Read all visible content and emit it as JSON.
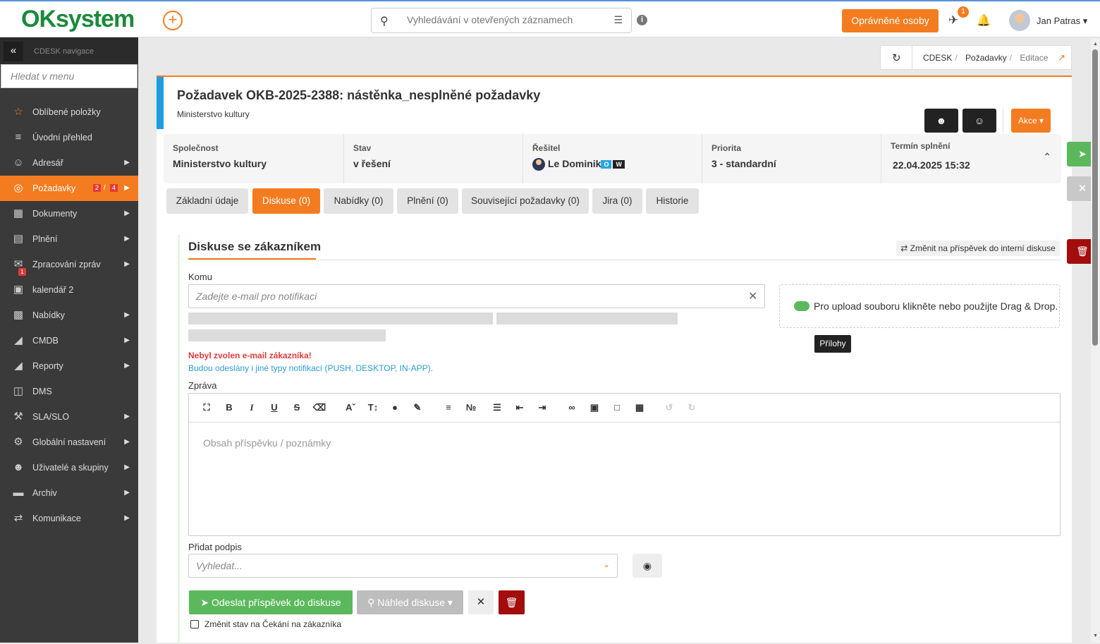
{
  "app": {
    "logo": "OKsystem"
  },
  "header": {
    "search_placeholder": "Vyhledávání v otevřených záznamech",
    "authorized_button": "Oprávněné osoby",
    "notification_count": "1",
    "user_name": "Jan Patras ▾",
    "accent_color": "#f47c20"
  },
  "sidebar": {
    "title": "CDESK navigace",
    "search_placeholder": "Hledat v menu",
    "items": [
      {
        "label": "Oblíbené položky",
        "icon": "star-icon"
      },
      {
        "label": "Úvodní přehled",
        "icon": "list-icon"
      },
      {
        "label": "Adresář",
        "icon": "user-icon"
      },
      {
        "label": "Požadavky",
        "icon": "lifebuoy-icon",
        "count_a": "2",
        "count_b": "4"
      },
      {
        "label": "Dokumenty",
        "icon": "books-icon"
      },
      {
        "label": "Plnění",
        "icon": "clipboard-icon"
      },
      {
        "label": "Zpracování zpráv",
        "icon": "envelope-icon",
        "badge": "1"
      },
      {
        "label": "kalendář 2",
        "icon": "calendar-icon"
      },
      {
        "label": "Nabídky",
        "icon": "gift-icon"
      },
      {
        "label": "CMDB",
        "icon": "folder-open-icon"
      },
      {
        "label": "Reporty",
        "icon": "folder-open-icon"
      },
      {
        "label": "DMS",
        "icon": "database-icon"
      },
      {
        "label": "SLA/SLO",
        "icon": "gavel-icon"
      },
      {
        "label": "Globální nastavení",
        "icon": "gears-icon"
      },
      {
        "label": "Uživatelé a skupiny",
        "icon": "users-icon"
      },
      {
        "label": "Archiv",
        "icon": "archive-icon"
      },
      {
        "label": "Komunikace",
        "icon": "exchange-icon"
      }
    ]
  },
  "breadcrumb": {
    "items": [
      "CDESK",
      "Požadavky",
      "Editace"
    ]
  },
  "request": {
    "title": "Požadavek OKB-2025-2388: nástěnka_nesplněné požadavky",
    "subtitle": "Ministerstvo kultury",
    "akce_label": "Akce ▾",
    "fields": [
      {
        "label": "Společnost",
        "value": "Ministerstvo kultury"
      },
      {
        "label": "Stav",
        "value": "v řešení"
      },
      {
        "label": "Řešitel",
        "value": "Le Dominik",
        "tag_o": "O",
        "tag_w": "W"
      },
      {
        "label": "Priorita",
        "value": "3 - standardní"
      },
      {
        "label": "Termín splnění",
        "value": "22.04.2025 15:32"
      }
    ]
  },
  "tabs": [
    "Základní údaje",
    "Diskuse (0)",
    "Nabídky (0)",
    "Plnění (0)",
    "Související požadavky (0)",
    "Jira (0)",
    "Historie"
  ],
  "discussion": {
    "title": "Diskuse se zákazníkem",
    "switch_label": "⇄ Změnit na příspěvek do interní diskuse",
    "to_label": "Komu",
    "to_placeholder": "Zadejte e-mail pro notifikaci",
    "error": "Nebyl zvolen e-mail zákazníka!",
    "note": "Budou odeslány i jiné typy notifikací (PUSH, DESKTOP, IN-APP).",
    "upload_text": "Pro upload souboru klikněte nebo použijte Drag & Drop.",
    "attachments_tooltip": "Přílohy",
    "message_label": "Zpráva",
    "message_placeholder": "Obsah příspěvku / poznámky",
    "signature_label": "Přidat podpis",
    "signature_placeholder": "Vyhledat...",
    "send_label": "Odeslat příspěvek do diskuse",
    "preview_label": "Náhled diskuse ▾",
    "checkbox_label": "Změnit stav na Čekání na zákazníka"
  }
}
